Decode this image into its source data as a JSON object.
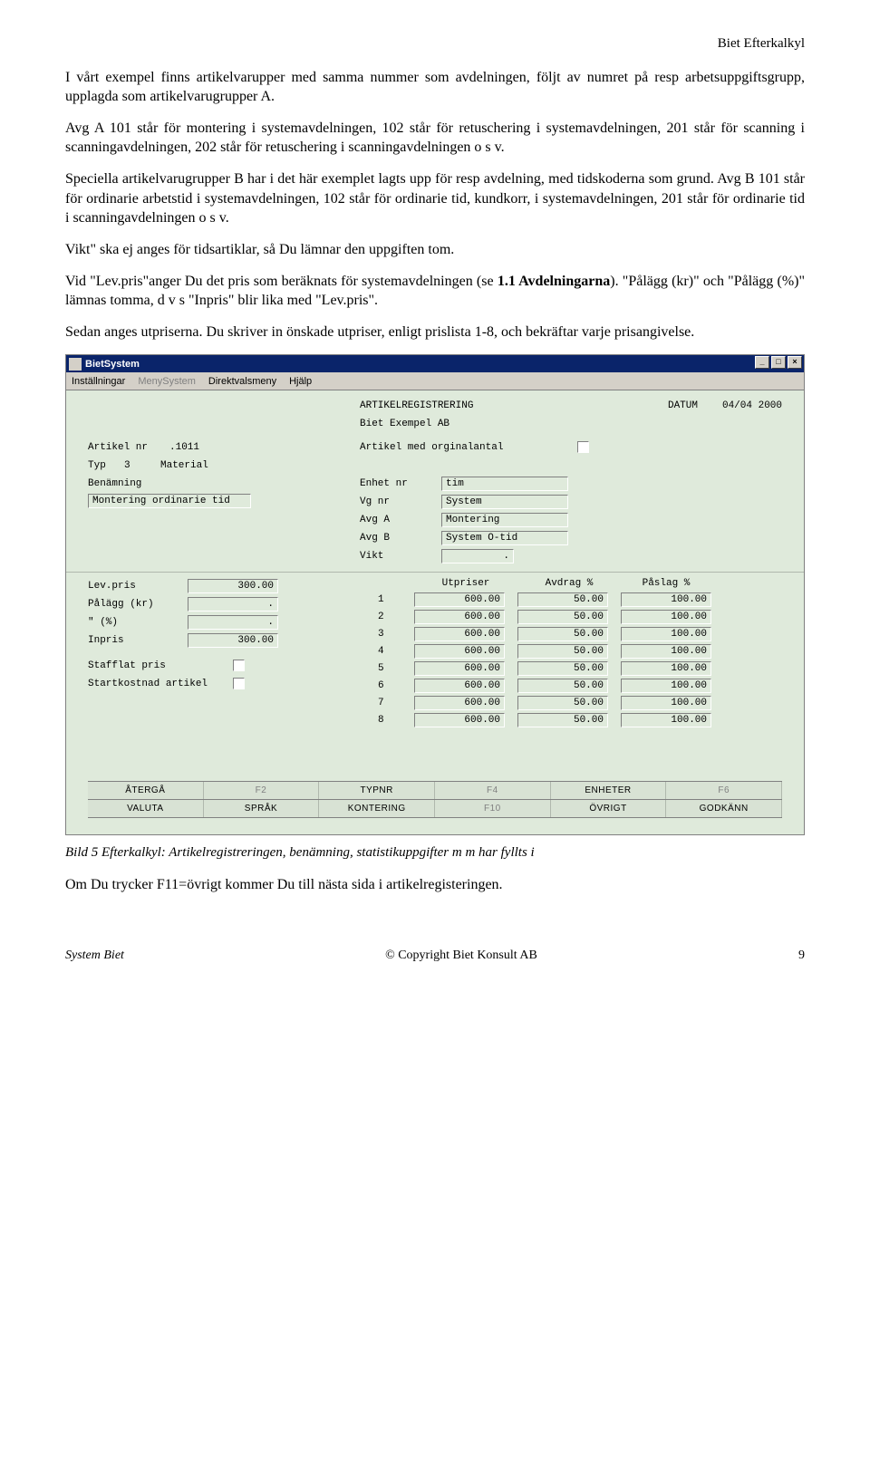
{
  "doc": {
    "header": "Biet Efterkalkyl",
    "p1": "I vårt exempel finns artikelvarupper med samma nummer som avdelningen, följt av numret på resp arbetsuppgiftsgrupp, upplagda som artikelvarugrupper A.",
    "p2": "Avg A 101 står för montering i systemavdelningen, 102 står för retuschering i systemavdelningen, 201 står för scanning i scanningavdelningen, 202 står för retuschering i scanningavdelningen o s v.",
    "p3": "Speciella artikelvarugrupper B har i det här exemplet lagts upp för resp avdelning, med tidskoderna som grund. Avg B 101 står för ordinarie arbetstid i systemavdelningen, 102 står för ordinarie tid, kundkorr, i systemavdelningen, 201 står för ordinarie tid i scanningavdelningen o s v.",
    "p4": "Vikt\" ska ej anges för tidsartiklar, så Du lämnar den uppgiften tom.",
    "p5a": "Vid \"Lev.pris\"anger Du det pris som beräknats för systemavdelningen (se ",
    "p5b": "1.1 Avdelningarna",
    "p5c": "). \"Pålägg (kr)\" och \"Pålägg (%)\" lämnas tomma, d v s \"Inpris\" blir lika med \"Lev.pris\".",
    "p6": "Sedan anges utpriserna. Du skriver in önskade utpriser, enligt prislista 1-8, och bekräftar varje prisangivelse.",
    "caption": "Bild 5 Efterkalkyl: Artikelregistreringen, benämning, statistikuppgifter  m m har fyllts i",
    "p7": "Om Du trycker F11=övrigt kommer Du till nästa sida i artikelregisteringen.",
    "footer_left": "System Biet",
    "footer_center": "© Copyright Biet Konsult AB",
    "footer_page": "9"
  },
  "app": {
    "title": "BietSystem",
    "menu": [
      "Inställningar",
      "MenySystem",
      "Direktvalsmeny",
      "Hjälp"
    ],
    "menu_dim": [
      false,
      true,
      false,
      false
    ],
    "screenTitle": "ARTIKELREGISTRERING",
    "dateLabel": "DATUM",
    "date": "04/04 2000",
    "company": "Biet Exempel AB",
    "lbl_artikelnr": "Artikel nr",
    "artikelnr": ".1011",
    "lbl_organtal": "Artikel med orginalantal",
    "lbl_typ": "Typ",
    "typ": "3",
    "typText": "Material",
    "lbl_benamning": "Benämning",
    "benamning": "Montering ordinarie tid",
    "lbl_enhet": "Enhet nr",
    "enhet": "tim",
    "lbl_vg": "Vg nr",
    "vg": "System",
    "lbl_avga": "Avg A",
    "avga": "Montering",
    "lbl_avgb": "Avg B",
    "avgb": "System O-tid",
    "lbl_vikt": "Vikt",
    "vikt": ".",
    "lbl_levpris": "Lev.pris",
    "levpris": "300.00",
    "lbl_palaggkr": "Pålägg (kr)",
    "palaggkr": ".",
    "lbl_palaggpct": "\"      (%)",
    "palaggpct": ".",
    "lbl_inpris": "Inpris",
    "inpris": "300.00",
    "lbl_stafflat": "Stafflat pris",
    "lbl_startkost": "Startkostnad artikel",
    "hdr_utpriser": "Utpriser",
    "hdr_avdrag": "Avdrag %",
    "hdr_paslag": "Påslag %",
    "prices": [
      {
        "idx": "1",
        "ut": "600.00",
        "av": "50.00",
        "pa": "100.00"
      },
      {
        "idx": "2",
        "ut": "600.00",
        "av": "50.00",
        "pa": "100.00"
      },
      {
        "idx": "3",
        "ut": "600.00",
        "av": "50.00",
        "pa": "100.00"
      },
      {
        "idx": "4",
        "ut": "600.00",
        "av": "50.00",
        "pa": "100.00"
      },
      {
        "idx": "5",
        "ut": "600.00",
        "av": "50.00",
        "pa": "100.00"
      },
      {
        "idx": "6",
        "ut": "600.00",
        "av": "50.00",
        "pa": "100.00"
      },
      {
        "idx": "7",
        "ut": "600.00",
        "av": "50.00",
        "pa": "100.00"
      },
      {
        "idx": "8",
        "ut": "600.00",
        "av": "50.00",
        "pa": "100.00"
      }
    ],
    "fkeys1": [
      "ÅTERGÅ",
      "F2",
      "TYPNR",
      "F4",
      "ENHETER",
      "F6"
    ],
    "fkeys1_dim": [
      false,
      true,
      false,
      true,
      false,
      true
    ],
    "fkeys2": [
      "VALUTA",
      "SPRÅK",
      "KONTERING",
      "F10",
      "ÖVRIGT",
      "GODKÄNN"
    ],
    "fkeys2_dim": [
      false,
      false,
      false,
      true,
      false,
      false
    ]
  }
}
